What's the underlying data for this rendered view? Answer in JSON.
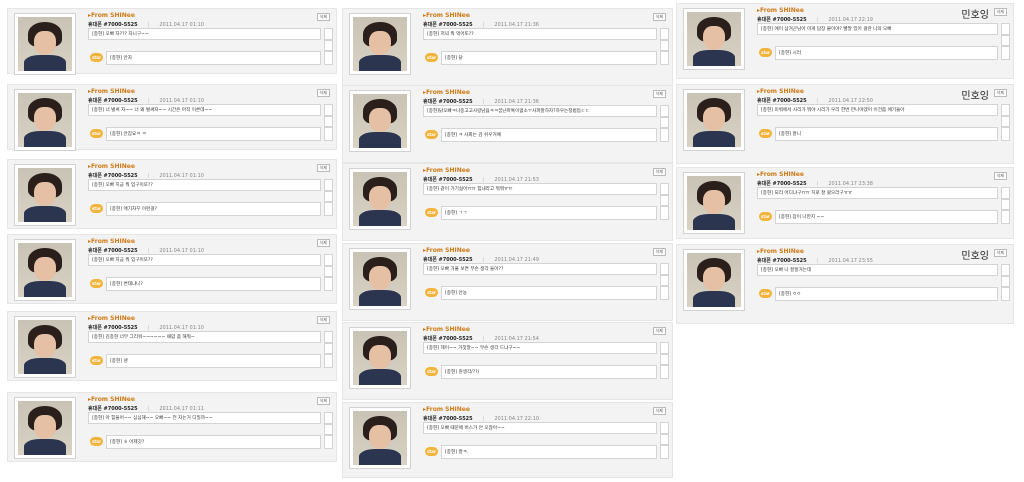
{
  "labels": {
    "from": "From SHINee",
    "sender": "휴대폰 #7000-5525",
    "delete": "삭제",
    "star": "star",
    "sep": "|"
  },
  "cards": [
    {
      "date": "2011.04.17 01:10",
      "message": "[종현] 오빠 자??? 자니구~~",
      "reply": "[종현] 안자"
    },
    {
      "date": "2011.04.17 01:10",
      "message": "[종현] 너 벌써 자~~ 너 왜 벌써자~~ 시간은 아직 이른데~~",
      "reply": "[종현] 안잠요ㅋ ㅋ"
    },
    {
      "date": "2011.04.17 01:10",
      "message": "[종현] 오빠 지금 뭐 입구이또??",
      "reply": "[종현] 애기자꾸 이런걸?"
    },
    {
      "date": "2011.04.17 01:10",
      "message": "[종현] 오빠 지금 뭐 입구이또??",
      "reply": "[종현] 변태냐니?"
    },
    {
      "date": "2011.04.17 01:10",
      "message": "[종현] 김종현 너무 그리워~~~~~~ 때맘 좀 해줘~",
      "reply": "[종현] 넹"
    },
    {
      "date": "2011.04.17 01:11",
      "message": "[종현] 아 힘들어~~ 심심해~~ 오빠~~ 전 자는거 디밀까~~",
      "reply": "[종현] ㅎ 어제갓?"
    },
    {
      "date": "2011.04.17 21:36",
      "message": "[종현] 저녁 뭐 먹어또??",
      "reply": "[종현] 닭"
    },
    {
      "date": "2011.04.17 21:36",
      "message": "[종현]닭오빠ㅋ나중고고사랑남윰ㅋㅋ꿈냔파톡이없소ㅜ사파잘하자?하우는정법듬ㄷㄷ",
      "reply": "[종현] ㅋ 사회는 감 쉬우거예"
    },
    {
      "date": "2011.04.17 21:53",
      "message": "[종현] 같이 가기싫어ㅠㅠ 힘내라고 뭐뭐ㅠㅠ",
      "reply": "[종현] ㄱㄱ"
    },
    {
      "date": "2011.04.17 21:49",
      "message": "[종현] 오빠 거울 보면 무슨 생각 들어??",
      "reply": "[종현] 안뇽"
    },
    {
      "date": "2011.04.17 21:54",
      "message": "[종현] 헤이~~ 거짓말~~ 무슨 생각 드냐구~~",
      "reply": "[종현] 뭔생각/??/"
    },
    {
      "date": "2011.04.17 22:10",
      "message": "[종현] 오빠 때문에 버스가 안 오잖아~~",
      "reply": "[종현] 잘ㅋ."
    },
    {
      "date": "2011.04.17 22:19",
      "message": "[종현] 에이 삼겨굔남아 이게 답장 붙이야? 빨말 있어 걸란 나의 오빠",
      "reply": "[종현] 시러"
    },
    {
      "date": "2011.04.17 22:50",
      "message": "[종현] 미뤄에서 사리가 뭐야 시리가 우리 한번 만나야겠어 이건좀 애기들아",
      "reply": "[종현] 잘니"
    },
    {
      "date": "2011.04.17 23:38",
      "message": "[종현] 되리 어디냐구ㅠㅠ 치로 잘 왔으라구ㅠㅠ",
      "reply": "[종현] 잠이 나만지 ~~"
    },
    {
      "date": "2011.04.17 23:55",
      "message": "[종현] 오빠 나 잘할거는데",
      "reply": "[종현] ㅇㅇ"
    }
  ],
  "signatures": [
    "민호잉",
    "민호잉",
    "민호잉"
  ]
}
